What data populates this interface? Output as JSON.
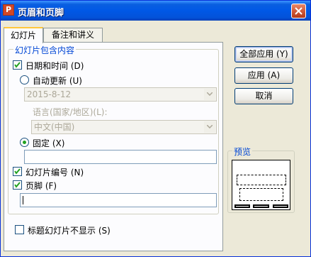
{
  "window": {
    "title": "页眉和页脚",
    "app_icon_letter": "P"
  },
  "tabs": [
    {
      "label": "幻灯片",
      "active": true
    },
    {
      "label": "备注和讲义",
      "active": false
    }
  ],
  "slide_content": {
    "group_label": "幻灯片包含内容",
    "date_time": {
      "label": "日期和时间 (D)",
      "checked": true
    },
    "auto_update": {
      "label": "自动更新 (U)",
      "selected": false,
      "date_value": "2015-8-12"
    },
    "language": {
      "label": "语言(国家/地区)(L):",
      "value": "中文(中国)"
    },
    "fixed": {
      "label": "固定 (X)",
      "selected": true,
      "value": ""
    },
    "slide_number": {
      "label": "幻灯片编号 (N)",
      "checked": true
    },
    "footer": {
      "label": "页脚 (F)",
      "checked": true,
      "value": ""
    }
  },
  "hide_on_title": {
    "label": "标题幻灯片不显示 (S)",
    "checked": false
  },
  "buttons": {
    "apply_all": "全部应用 (Y)",
    "apply": "应用 (A)",
    "cancel": "取消"
  },
  "preview": {
    "label": "预览"
  },
  "colors": {
    "title_bar": "#0058e6",
    "legend_text": "#0046d5",
    "radio_dot": "#21a121",
    "check_mark": "#21a121"
  }
}
